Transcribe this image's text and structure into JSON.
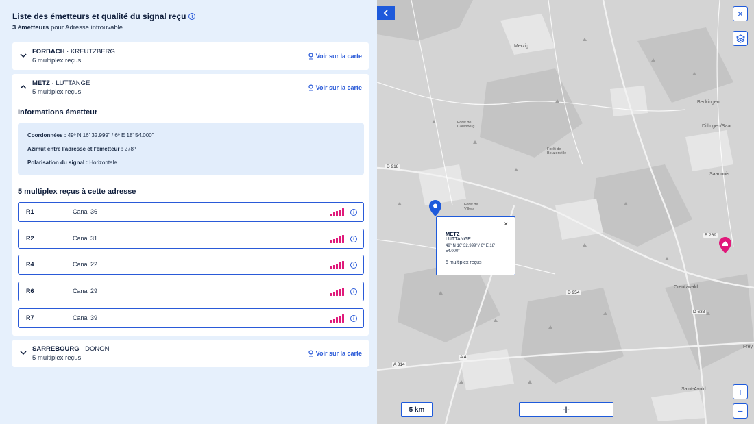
{
  "panel": {
    "title": "Liste des émetteurs et qualité du signal reçu",
    "subtitle_count": "3 émetteurs",
    "subtitle_rest": "pour Adresse introuvable"
  },
  "transmitters": [
    {
      "name": "FORBACH",
      "place": "KREUTZBERG",
      "count": "6 multiplex reçus",
      "link": "Voir sur la carte",
      "expanded": false
    },
    {
      "name": "METZ",
      "place": "LUTTANGE",
      "count": "5 multiplex reçus",
      "link": "Voir sur la carte",
      "expanded": true
    },
    {
      "name": "SARREBOURG",
      "place": "DONON",
      "count": "5 multiplex reçus",
      "link": "Voir sur la carte",
      "expanded": false
    }
  ],
  "details": {
    "heading": "Informations émetteur",
    "coords_label": "Coordonnées :",
    "coords_value": "49º N 16' 32.999\" / 6º E 18' 54.000\"",
    "azimuth_label": "Azimut entre l'adresse et l'émetteur :",
    "azimuth_value": "278º",
    "polar_label": "Polarisation du signal :",
    "polar_value": "Horizontale",
    "mux_heading": "5 multiplex reçus à cette adresse"
  },
  "multiplexes": [
    {
      "id": "R1",
      "canal": "Canal 36",
      "signal": 4
    },
    {
      "id": "R2",
      "canal": "Canal 31",
      "signal": 4
    },
    {
      "id": "R4",
      "canal": "Canal 22",
      "signal": 4
    },
    {
      "id": "R6",
      "canal": "Canal 29",
      "signal": 4
    },
    {
      "id": "R7",
      "canal": "Canal 39",
      "signal": 4
    }
  ],
  "popup": {
    "title": "METZ",
    "subtitle": "LUTTANGE",
    "coords": "49º N 16' 32.999\" / 6º E 18' 54.000\"",
    "mux": "5 multiplex reçus",
    "close": "×"
  },
  "map": {
    "places": [
      "Merzig",
      "Beckingen",
      "Dillingen/Saar",
      "Saarlouis",
      "Creutzwald",
      "Saint-Avold",
      "Frey",
      "Forêt de Calenberg",
      "Forêt de Bouzonville",
      "Forêt de Villers"
    ],
    "roads": [
      "D 918",
      "D 954",
      "D 633",
      "B 269",
      "A 4",
      "A 314"
    ],
    "scale": "5 km",
    "scale_mid": "-|-",
    "zoom_in": "+",
    "zoom_out": "−",
    "close": "×"
  },
  "colors": {
    "accent": "#1e5adb",
    "signal": "#e0197a"
  }
}
